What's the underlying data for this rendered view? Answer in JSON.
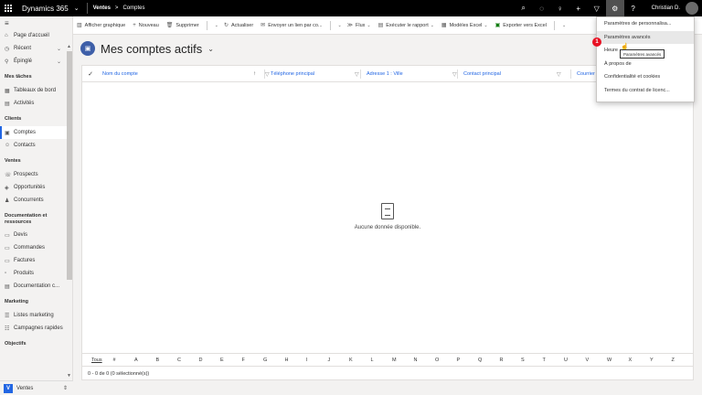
{
  "topbar": {
    "app_title": "Dynamics 365",
    "area": "Ventes",
    "crumb_sep": ">",
    "entity": "Comptes",
    "user": "Christian D."
  },
  "sidebar": {
    "top_items": [
      {
        "label": "Page d'accueil",
        "icon": "home-icon"
      },
      {
        "label": "Récent",
        "icon": "clock-icon"
      },
      {
        "label": "Épinglé",
        "icon": "pin-icon"
      }
    ],
    "groups": [
      {
        "title": "Mes tâches",
        "items": [
          {
            "label": "Tableaux de bord",
            "icon": "dashboard-icon"
          },
          {
            "label": "Activités",
            "icon": "activities-icon"
          }
        ]
      },
      {
        "title": "Clients",
        "items": [
          {
            "label": "Comptes",
            "icon": "account-icon",
            "selected": true
          },
          {
            "label": "Contacts",
            "icon": "contact-icon"
          }
        ]
      },
      {
        "title": "Ventes",
        "items": [
          {
            "label": "Prospects",
            "icon": "leads-icon"
          },
          {
            "label": "Opportunités",
            "icon": "opportunity-icon"
          },
          {
            "label": "Concurrents",
            "icon": "competitor-icon"
          }
        ]
      },
      {
        "title": "Documentation et ressources",
        "items": [
          {
            "label": "Devis",
            "icon": "quote-icon"
          },
          {
            "label": "Commandes",
            "icon": "order-icon"
          },
          {
            "label": "Factures",
            "icon": "invoice-icon"
          },
          {
            "label": "Produits",
            "icon": "product-icon"
          },
          {
            "label": "Documentation c...",
            "icon": "doc-icon"
          }
        ]
      },
      {
        "title": "Marketing",
        "items": [
          {
            "label": "Listes marketing",
            "icon": "list-icon"
          },
          {
            "label": "Campagnes rapides",
            "icon": "campaign-icon"
          }
        ]
      },
      {
        "title": "Objectifs",
        "items": []
      }
    ],
    "area_badge": "V",
    "area_name": "Ventes"
  },
  "commands": [
    {
      "label": "Afficher graphique",
      "icon": "chart-icon"
    },
    {
      "label": "Nouveau",
      "icon": "plus-icon"
    },
    {
      "label": "Supprimer",
      "icon": "trash-icon"
    },
    {
      "label": "Actualiser",
      "icon": "refresh-icon"
    },
    {
      "label": "Envoyer un lien par co...",
      "icon": "mail-link-icon"
    },
    {
      "label": "Flux",
      "icon": "flow-icon"
    },
    {
      "label": "Exécuter le rapport",
      "icon": "report-icon"
    },
    {
      "label": "Modèles Excel",
      "icon": "excel-template-icon"
    },
    {
      "label": "Exporter vers Excel",
      "icon": "excel-export-icon"
    }
  ],
  "view": {
    "title": "Mes comptes actifs"
  },
  "grid": {
    "columns": [
      "Nom du compte",
      "Téléphone principal",
      "Adresse 1 : Ville",
      "Contact principal",
      "Courrier"
    ],
    "empty_message": "Aucune donnée disponible.",
    "alpha": [
      "Tous",
      "#",
      "A",
      "B",
      "C",
      "D",
      "E",
      "F",
      "G",
      "H",
      "I",
      "J",
      "K",
      "L",
      "M",
      "N",
      "O",
      "P",
      "Q",
      "R",
      "S",
      "T",
      "U",
      "V",
      "W",
      "X",
      "Y",
      "Z"
    ],
    "footer": "0 - 0 de 0 (0 sélectionné(s))"
  },
  "settings_menu": {
    "items": [
      "Paramètres de personnalisa...",
      "Paramètres avancés",
      "Heure ...",
      "À propos de",
      "Confidentialité et cookies",
      "Termes du contrat de licenc..."
    ],
    "step_marker": "1",
    "tooltip": "Paramètres avancés"
  }
}
